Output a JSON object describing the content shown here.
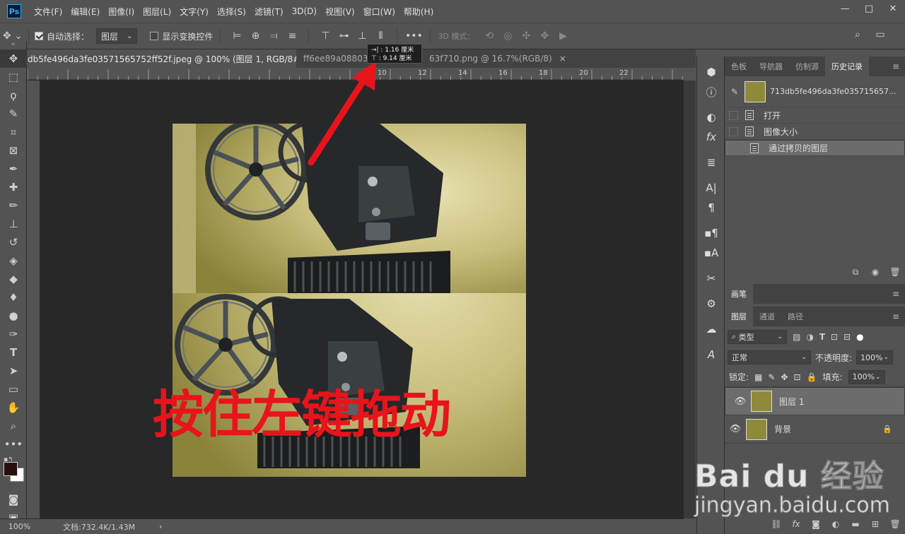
{
  "app": {
    "logo": "Ps"
  },
  "menu": [
    "文件(F)",
    "编辑(E)",
    "图像(I)",
    "图层(L)",
    "文字(Y)",
    "选择(S)",
    "滤镜(T)",
    "3D(D)",
    "视图(V)",
    "窗口(W)",
    "帮助(H)"
  ],
  "window_controls": {
    "minimize": "—",
    "restore": "□",
    "close": "✕"
  },
  "options": {
    "auto_select_label": "自动选择：",
    "auto_select_value": "图层",
    "show_transform_label": "显示变换控件",
    "mode_3d_label": "3D 模式：",
    "more": "•••"
  },
  "tabs": [
    {
      "label": "db5fe496da3fe03571565752ff52f.jpeg @ 100% (图层 1, RGB/8#) *",
      "close": "×",
      "active": true
    },
    {
      "label": "ff6ee89a088031",
      "close": "",
      "active": false
    },
    {
      "label": "63f710.png @ 16.7%(RGB/8)",
      "close": "×",
      "active": false
    }
  ],
  "ruler_labels": [
    "10",
    "12",
    "14",
    "16",
    "18",
    "20",
    "22"
  ],
  "tooltip": {
    "line1": "→| :  1.16 厘米",
    "line2": "⊤ :  9.14 厘米"
  },
  "overlay_text": "按住左键拖动",
  "status": {
    "zoom": "100%",
    "doc": "文档:732.4K/1.43M",
    "arrow": "›"
  },
  "panels": {
    "top_tabs": [
      "色板",
      "导航器",
      "仿制源",
      "历史记录"
    ],
    "history": {
      "snapshot_name": "713db5fe496da3fe035715657...",
      "items": [
        "打开",
        "图像大小",
        "通过拷贝的图层"
      ]
    },
    "brush_tab": "画笔",
    "layer_tabs": [
      "图层",
      "通道",
      "路径"
    ],
    "filter_kind": "类型",
    "blend_mode": "正常",
    "opacity_label": "不透明度:",
    "opacity_value": "100%",
    "lock_label": "锁定:",
    "fill_label": "填充:",
    "fill_value": "100%",
    "layers": [
      {
        "name": "图层 1",
        "selected": true,
        "locked": false
      },
      {
        "name": "背景",
        "selected": false,
        "locked": true
      }
    ]
  },
  "watermark": {
    "brand": "Bai du 经验",
    "url": "jingyan.baidu.com"
  },
  "colors": {
    "accent_red": "#e8141b",
    "bg": "#535353",
    "canvas": "#282828"
  }
}
